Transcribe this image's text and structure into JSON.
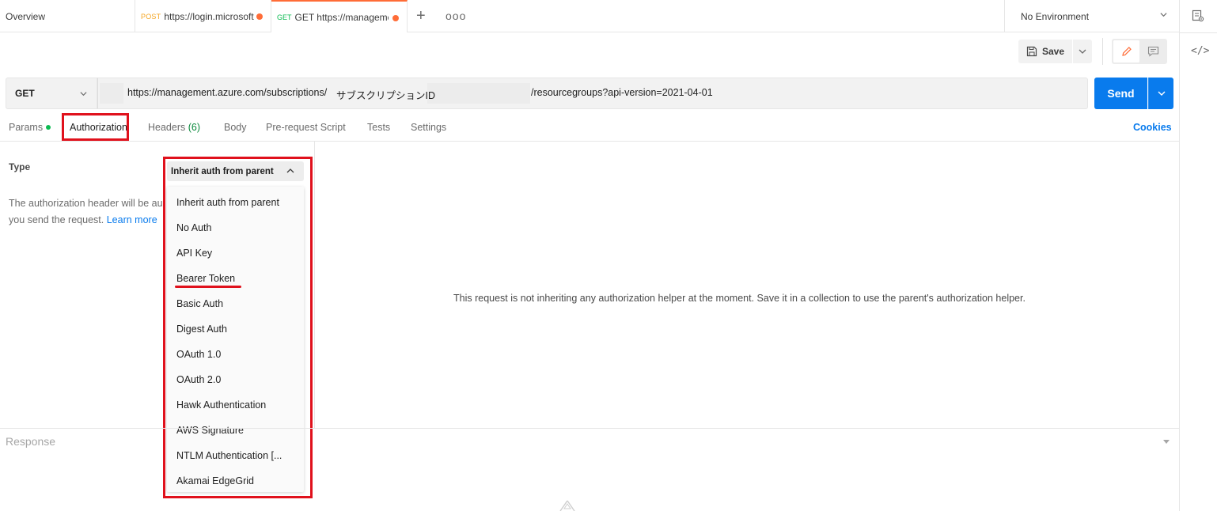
{
  "tabs": [
    {
      "label": "Overview"
    },
    {
      "method": "POST",
      "label": "https://login.microsoft"
    },
    {
      "method": "GET",
      "label": "GET https://management"
    }
  ],
  "tabbar": {
    "add": "+",
    "more": "ooo"
  },
  "environment": {
    "label": "No Environment"
  },
  "toolbar": {
    "save_label": "Save"
  },
  "request": {
    "method": "GET",
    "url_prefix": "https://management.azure.com/subscriptions/",
    "url_subscription": "サブスクリプションID",
    "url_suffix": "/resourcegroups?api-version=2021-04-01",
    "send_label": "Send"
  },
  "request_tabs": [
    {
      "label": "Params"
    },
    {
      "label": "Authorization"
    },
    {
      "label": "Headers",
      "count": "(6)"
    },
    {
      "label": "Body"
    },
    {
      "label": "Pre-request Script"
    },
    {
      "label": "Tests"
    },
    {
      "label": "Settings"
    }
  ],
  "cookies_label": "Cookies",
  "auth": {
    "type_label": "Type",
    "selected": "Inherit auth from parent",
    "description_1": "The authorization header will be au",
    "description_2": "you send the request.",
    "learn_more": "Learn more",
    "options": [
      "Inherit auth from parent",
      "No Auth",
      "API Key",
      "Bearer Token",
      "Basic Auth",
      "Digest Auth",
      "OAuth 1.0",
      "OAuth 2.0",
      "Hawk Authentication",
      "AWS Signature",
      "NTLM Authentication [...",
      "Akamai EdgeGrid"
    ],
    "message": "This request is not inheriting any authorization helper at the moment. Save it in a collection to use the parent's authorization helper."
  },
  "response": {
    "label": "Response"
  },
  "colors": {
    "accent": "#ff6c37",
    "send": "#097bed",
    "highlight": "#e0111c"
  }
}
